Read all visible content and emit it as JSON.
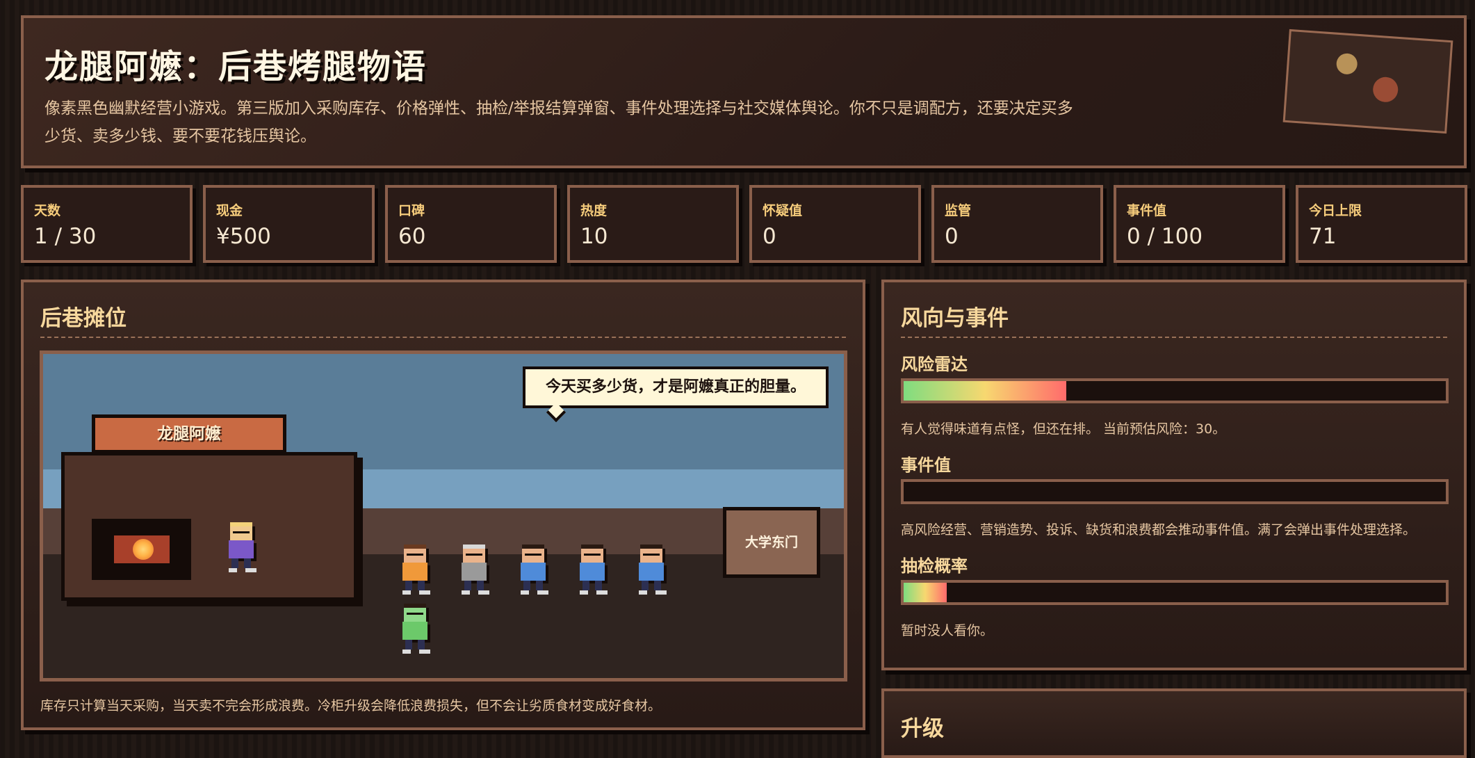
{
  "header": {
    "title": "龙腿阿嬷：后巷烤腿物语",
    "subtitle": "像素黑色幽默经营小游戏。第三版加入采购库存、价格弹性、抽检/举报结算弹窗、事件处理选择与社交媒体舆论。你不只是调配方，还要决定买多少货、卖多少钱、要不要花钱压舆论。"
  },
  "stats": [
    {
      "label": "天数",
      "value": "1 / 30"
    },
    {
      "label": "现金",
      "value": "¥500"
    },
    {
      "label": "口碑",
      "value": "60"
    },
    {
      "label": "热度",
      "value": "10"
    },
    {
      "label": "怀疑值",
      "value": "0"
    },
    {
      "label": "监管",
      "value": "0"
    },
    {
      "label": "事件值",
      "value": "0 / 100"
    },
    {
      "label": "今日上限",
      "value": "71"
    }
  ],
  "stall": {
    "title": "后巷摊位",
    "shop_sign": "龙腿阿嬷",
    "speech": "今天买多少货，才是阿嬷真正的胆量。",
    "gate_label": "大学东门",
    "note": "库存只计算当天采购，当天卖不完会形成浪费。冷柜升级会降低浪费损失，但不会让劣质食材变成好食材。"
  },
  "events": {
    "title": "风向与事件",
    "meters": [
      {
        "label": "风险雷达",
        "fill": 0.3,
        "text": "有人觉得味道有点怪，但还在排。 当前预估风险：30。"
      },
      {
        "label": "事件值",
        "fill": 0.0,
        "text": "高风险经营、营销造势、投诉、缺货和浪费都会推动事件值。满了会弹出事件处理选择。"
      },
      {
        "label": "抽检概率",
        "fill": 0.08,
        "text": "暂时没人看你。"
      }
    ]
  },
  "upgrade": {
    "title": "升级"
  },
  "colors": {
    "accent": "#f7d89d",
    "border": "#8a5f4b",
    "panel_bg": "#2a1b17",
    "meter_start": "#7fdc7f",
    "meter_mid": "#f7d870",
    "meter_end": "#ff6b6b"
  }
}
